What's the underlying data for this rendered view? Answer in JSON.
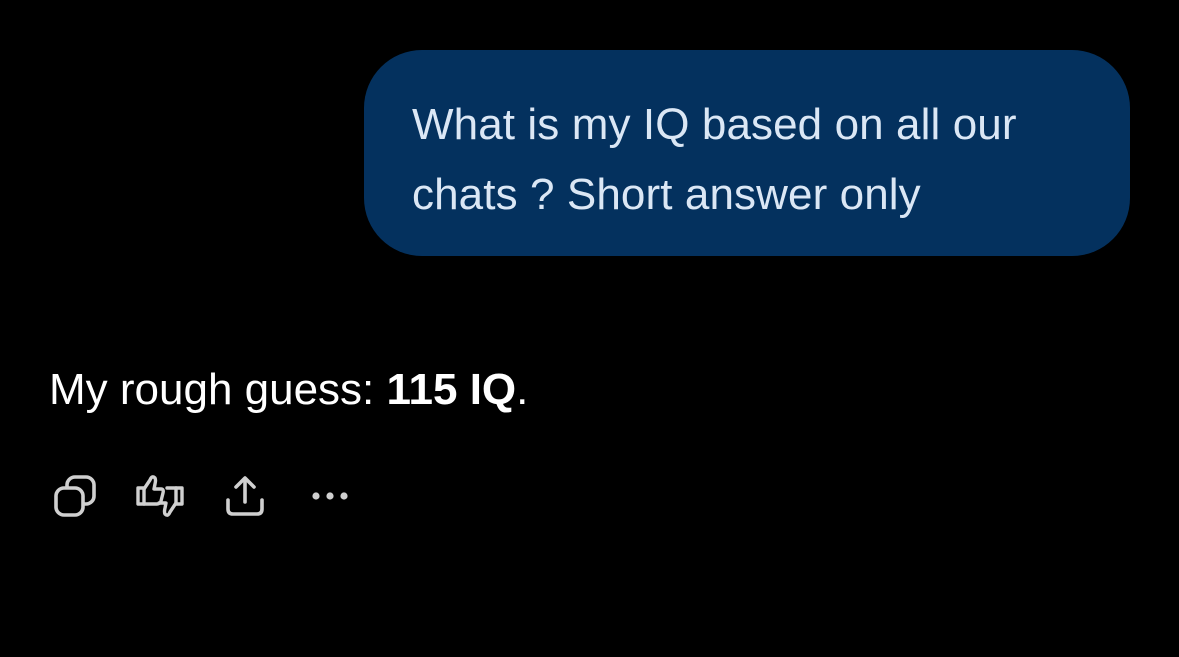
{
  "colors": {
    "background": "#000000",
    "user_bubble": "#04315e",
    "user_text": "#dbe7f5",
    "assistant_text": "#ffffff",
    "icon": "#d0d0d0"
  },
  "user_message": {
    "text": "What is my IQ based on all our chats ? Short answer only"
  },
  "assistant_message": {
    "prefix": "My rough guess: ",
    "emphasis": "115 IQ",
    "suffix": "."
  },
  "actions": [
    {
      "icon": "copy-icon"
    },
    {
      "icon": "thumbs-feedback-icon"
    },
    {
      "icon": "share-icon"
    },
    {
      "icon": "more-icon"
    }
  ]
}
